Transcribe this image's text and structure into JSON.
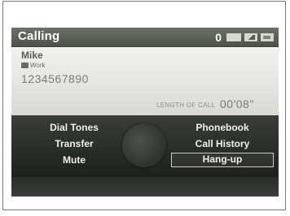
{
  "screen": {
    "title": "Calling",
    "status": {
      "count": "0",
      "icons": [
        "hfl-icon",
        "signal-strength-icon",
        "battery-icon"
      ]
    }
  },
  "caller": {
    "name": "Mike",
    "number_type": "Work",
    "number": "1234567890"
  },
  "call": {
    "length_label": "LENGTH OF CALL",
    "length_value": "00'08\""
  },
  "menu": {
    "dial_tones": "Dial Tones",
    "phonebook": "Phonebook",
    "transfer": "Transfer",
    "call_history": "Call History",
    "mute": "Mute",
    "hang_up": "Hang-up",
    "selected": "Hang-up"
  },
  "colors": {
    "screen_bg": "#1e221e",
    "title_bar": "#5b6057",
    "info_bg": "#e6e6e2",
    "menu_text": "#f0f0ec"
  }
}
